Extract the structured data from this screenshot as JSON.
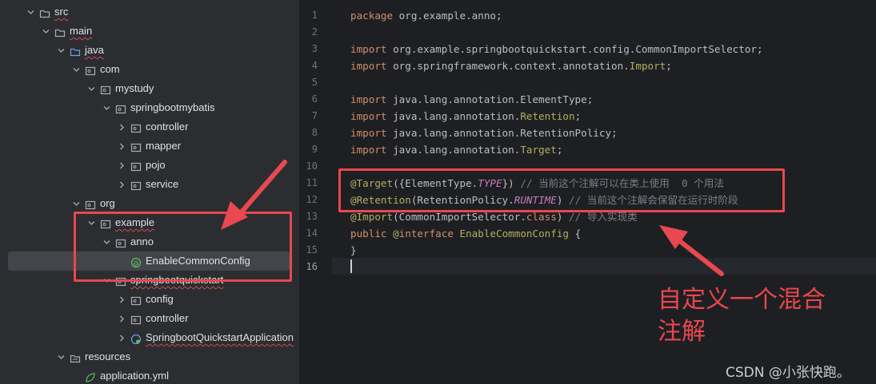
{
  "tree": [
    {
      "label": "src",
      "kind": "folder",
      "level": 0,
      "open": true,
      "chev": true,
      "squiggle": true
    },
    {
      "label": "main",
      "kind": "folder",
      "level": 1,
      "open": true,
      "chev": true,
      "squiggle": true
    },
    {
      "label": "java",
      "kind": "folder-blue",
      "level": 2,
      "open": true,
      "chev": true,
      "squiggle": true
    },
    {
      "label": "com",
      "kind": "package",
      "level": 3,
      "open": true,
      "chev": true
    },
    {
      "label": "mystudy",
      "kind": "package",
      "level": 4,
      "open": true,
      "chev": true
    },
    {
      "label": "springbootmybatis",
      "kind": "package",
      "level": 5,
      "open": true,
      "chev": true
    },
    {
      "label": "controller",
      "kind": "package",
      "level": 6,
      "open": false,
      "chev": true
    },
    {
      "label": "mapper",
      "kind": "package",
      "level": 6,
      "open": false,
      "chev": true
    },
    {
      "label": "pojo",
      "kind": "package",
      "level": 6,
      "open": false,
      "chev": true
    },
    {
      "label": "service",
      "kind": "package",
      "level": 6,
      "open": false,
      "chev": true
    },
    {
      "label": "org",
      "kind": "package",
      "level": 3,
      "open": true,
      "chev": true
    },
    {
      "label": "example",
      "kind": "package",
      "level": 4,
      "open": true,
      "chev": true,
      "squiggle": true
    },
    {
      "label": "anno",
      "kind": "package",
      "level": 5,
      "open": true,
      "chev": true
    },
    {
      "label": "EnableCommonConfig",
      "kind": "annotation",
      "level": 6,
      "open": false,
      "chev": false,
      "selected": true
    },
    {
      "label": "springbootquickstart",
      "kind": "package",
      "level": 5,
      "open": true,
      "chev": true,
      "squiggle": true
    },
    {
      "label": "config",
      "kind": "package",
      "level": 6,
      "open": false,
      "chev": true
    },
    {
      "label": "controller",
      "kind": "package",
      "level": 6,
      "open": false,
      "chev": true
    },
    {
      "label": "SpringbootQuickstartApplication",
      "kind": "spring-class",
      "level": 6,
      "open": false,
      "chev": true,
      "squiggle": true
    },
    {
      "label": "resources",
      "kind": "folder-res",
      "level": 2,
      "open": true,
      "chev": true
    },
    {
      "label": "application.yml",
      "kind": "yml",
      "level": 3,
      "open": false,
      "chev": false
    }
  ],
  "code_lines": [
    {
      "n": "1",
      "tokens": [
        [
          "kw",
          "package "
        ],
        [
          "cls",
          "org.example.anno;"
        ]
      ]
    },
    {
      "n": "2",
      "tokens": []
    },
    {
      "n": "3",
      "tokens": [
        [
          "kw",
          "import "
        ],
        [
          "cls",
          "org.example.springbootquickstart.config.CommonImportSelector;"
        ]
      ]
    },
    {
      "n": "4",
      "tokens": [
        [
          "kw",
          "import "
        ],
        [
          "cls",
          "org.springframework.context.annotation."
        ],
        [
          "ann",
          "Import"
        ],
        [
          "cls",
          ";"
        ]
      ]
    },
    {
      "n": "5",
      "tokens": []
    },
    {
      "n": "6",
      "tokens": [
        [
          "kw",
          "import "
        ],
        [
          "cls",
          "java.lang.annotation.ElementType;"
        ]
      ]
    },
    {
      "n": "7",
      "tokens": [
        [
          "kw",
          "import "
        ],
        [
          "cls",
          "java.lang.annotation."
        ],
        [
          "ann",
          "Retention"
        ],
        [
          "cls",
          ";"
        ]
      ]
    },
    {
      "n": "8",
      "tokens": [
        [
          "kw",
          "import "
        ],
        [
          "cls",
          "java.lang.annotation.RetentionPolicy;"
        ]
      ]
    },
    {
      "n": "9",
      "tokens": [
        [
          "kw",
          "import "
        ],
        [
          "cls",
          "java.lang.annotation."
        ],
        [
          "ann",
          "Target"
        ],
        [
          "cls",
          ";"
        ]
      ]
    },
    {
      "n": "10",
      "tokens": []
    },
    {
      "n": "11",
      "tokens": [
        [
          "ann",
          "@Target"
        ],
        [
          "cls",
          "({ElementType."
        ],
        [
          "ital",
          "TYPE"
        ],
        [
          "cls",
          "}) "
        ],
        [
          "cmt",
          "// 当前这个注解可以在类上使用  0 个用法"
        ]
      ]
    },
    {
      "n": "12",
      "tokens": [
        [
          "ann",
          "@Retention"
        ],
        [
          "cls",
          "(RetentionPolicy."
        ],
        [
          "ital",
          "RUNTIME"
        ],
        [
          "cls",
          ") "
        ],
        [
          "cmt",
          "// 当前这个注解会保留在运行时阶段"
        ]
      ]
    },
    {
      "n": "13",
      "tokens": [
        [
          "ann",
          "@Import"
        ],
        [
          "cls",
          "(CommonImportSelector."
        ],
        [
          "kw",
          "class"
        ],
        [
          "cls",
          ") "
        ],
        [
          "cmt",
          "// 导入实现类"
        ]
      ]
    },
    {
      "n": "14",
      "tokens": [
        [
          "kw",
          "public "
        ],
        [
          "ann",
          "@"
        ],
        [
          "kw",
          "interface "
        ],
        [
          "ann",
          "EnableCommonConfig"
        ],
        [
          "cls",
          " {"
        ]
      ]
    },
    {
      "n": "15",
      "tokens": [
        [
          "cls",
          "}"
        ]
      ]
    },
    {
      "n": "16",
      "tokens": []
    }
  ],
  "annotation_note": "自定义一个混合注解",
  "watermark": "CSDN @小张快跑。",
  "colors": {
    "highlight": "#e8484f",
    "panel": "#2b2d30",
    "editor": "#1e1f22"
  }
}
